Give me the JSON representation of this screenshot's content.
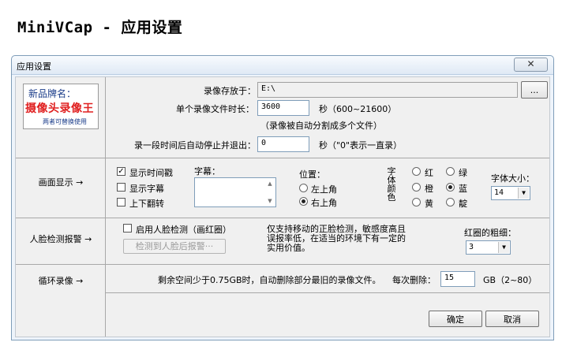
{
  "page_heading": "MiniVCap - 应用设置",
  "window": {
    "title": "应用设置",
    "close_glyph": "✕"
  },
  "logo": {
    "line1": "新品牌名：",
    "line2": "摄像头录像王",
    "line3": "两者可替换使用"
  },
  "sections": {
    "display": "画面显示 →",
    "face": "人脸检测报警 →",
    "loop": "循环录像 →"
  },
  "recording": {
    "save_to_label": "录像存放于：",
    "save_to_value": "E:\\",
    "browse_button": "...",
    "file_duration_label": "单个录像文件时长：",
    "file_duration_value": "3600",
    "file_duration_unit": "秒（600~21600）",
    "split_note": "（录像被自动分割成多个文件）",
    "auto_stop_label": "录一段时间后自动停止并退出：",
    "auto_stop_value": "0",
    "auto_stop_unit": "秒（\"0\"表示一直录）"
  },
  "display": {
    "show_time_label": "显示时间戳",
    "show_time_checked": true,
    "show_caption_label": "显示字幕",
    "show_caption_checked": false,
    "flip_label": "上下翻转",
    "flip_checked": false,
    "caption_label": "字幕：",
    "caption_value": "",
    "position_label": "位置：",
    "position_options": [
      "左上角",
      "右上角"
    ],
    "position_selected": "右上角",
    "font_color_label": "字体颜色",
    "colors": [
      "红",
      "绿",
      "橙",
      "蓝",
      "黄",
      "靛"
    ],
    "color_selected": "蓝",
    "font_size_label": "字体大小：",
    "font_size_value": "14"
  },
  "face": {
    "enable_label": "启用人脸检测（画红圈）",
    "enable_checked": false,
    "alarm_button": "检测到人脸后报警···",
    "note": "仅支持移动的正脸检测，敏感度高且误报率低，在适当的环境下有一定的实用价值。",
    "circle_width_label": "红圈的粗细：",
    "circle_width_value": "3"
  },
  "loop": {
    "note": "剩余空间少于0.75GB时，自动删除部分最旧的录像文件。",
    "delete_label": "每次删除：",
    "delete_value": "15",
    "delete_unit": "GB（2~80）"
  },
  "buttons": {
    "ok": "确定",
    "cancel": "取消"
  }
}
